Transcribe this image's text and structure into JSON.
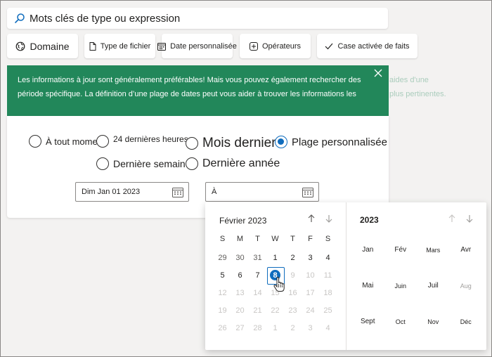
{
  "search": {
    "placeholder": "Mots clés de type ou expression"
  },
  "filters": [
    {
      "label": "Domaine",
      "icon": "globe-icon"
    },
    {
      "label": "Type de fichier",
      "icon": "file-icon"
    },
    {
      "label": "Date personnalisée",
      "icon": "calendar-icon"
    },
    {
      "label": "Opérateurs",
      "icon": "plus-box-icon"
    },
    {
      "label": "Case activée de faits",
      "icon": "checkmark-icon"
    }
  ],
  "banner": {
    "line1": "Les informations à jour sont généralement préférables! Mais vous pouvez également rechercher des",
    "line2": "période spécifique. La définition d’une plage de dates peut vous aider à trouver les informations les",
    "faded1": "aides d'une",
    "faded2": "plus pertinentes."
  },
  "date_options": [
    {
      "label": "À tout moment",
      "checked": false
    },
    {
      "label": "24 dernières heures",
      "checked": false
    },
    {
      "label": "Mois dernier",
      "checked": false
    },
    {
      "label": "Plage personnalisée",
      "checked": true
    },
    {
      "label": "Dernière semaine",
      "checked": false
    },
    {
      "label": "Dernière année",
      "checked": false
    }
  ],
  "from_date": {
    "value": "Dim Jan 01 2023"
  },
  "to_date": {
    "value": "À"
  },
  "calendar": {
    "month_title": "Février 2023",
    "weekdays": [
      "S",
      "M",
      "T",
      "W",
      "T",
      "F",
      "S"
    ],
    "days": [
      [
        "29",
        "30",
        "31",
        "1",
        "2",
        "3",
        "4"
      ],
      [
        "5",
        "6",
        "7",
        "8",
        "9",
        "10",
        "11"
      ],
      [
        "12",
        "13",
        "14",
        "15",
        "16",
        "17",
        "18"
      ],
      [
        "19",
        "20",
        "21",
        "22",
        "23",
        "24",
        "25"
      ],
      [
        "26",
        "27",
        "28",
        "1",
        "2",
        "3",
        "4"
      ]
    ],
    "selected_day": "8",
    "year_title": "2023",
    "months": [
      "Jan",
      "Fév",
      "Mars",
      "Avr",
      "Mai",
      "Juin",
      "Juil",
      "Aug",
      "Sept",
      "Oct",
      "Nov",
      "Déc"
    ]
  },
  "colors": {
    "accent": "#0f6cbd",
    "banner": "#22875a"
  }
}
